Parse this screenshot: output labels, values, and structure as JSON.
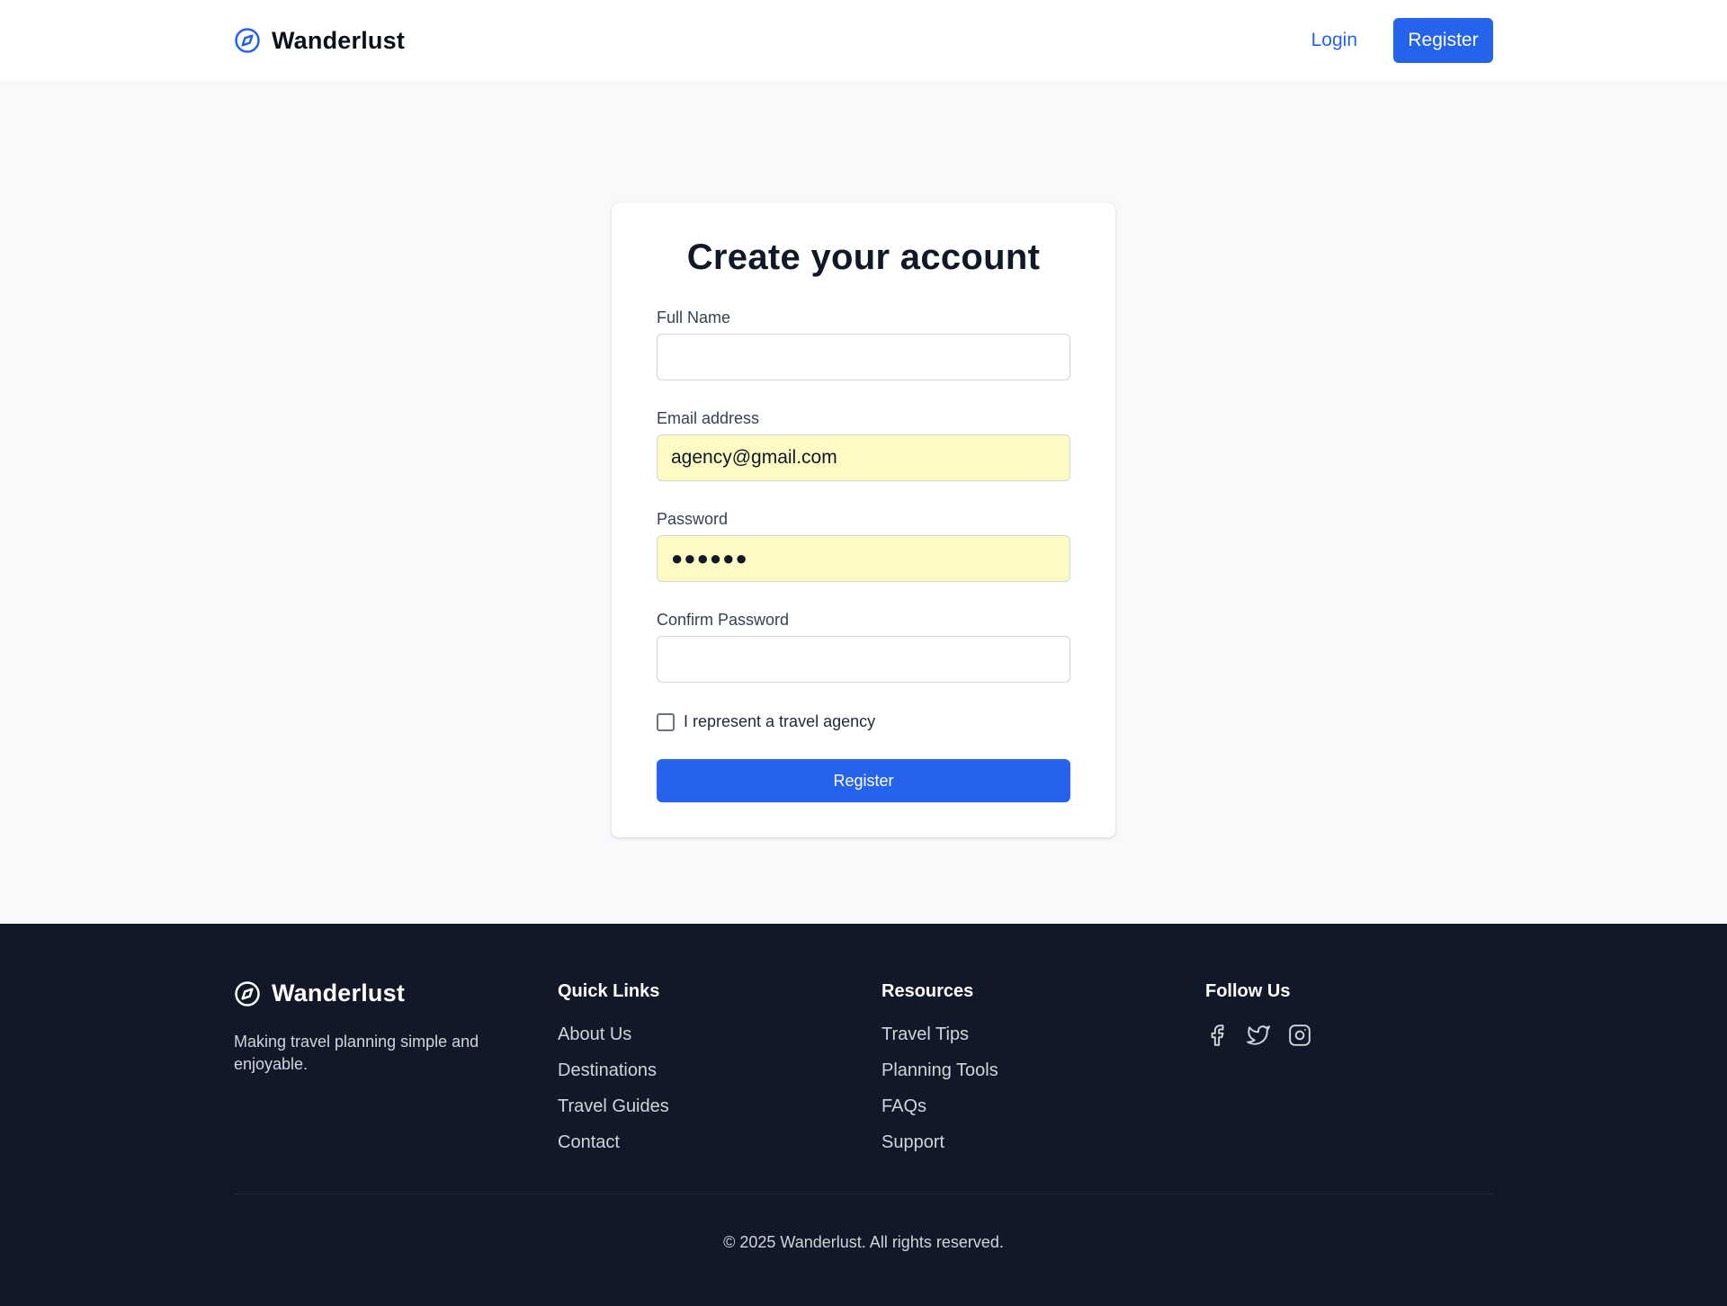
{
  "header": {
    "brand": "Wanderlust",
    "nav_login": "Login",
    "nav_register": "Register"
  },
  "form": {
    "title": "Create your account",
    "full_name": {
      "label": "Full Name",
      "value": ""
    },
    "email": {
      "label": "Email address",
      "value": "agency@gmail.com"
    },
    "password": {
      "label": "Password",
      "masked": "●●●●●●"
    },
    "confirm_password": {
      "label": "Confirm Password",
      "value": ""
    },
    "agency_checkbox": {
      "label": "I represent a travel agency",
      "checked": false
    },
    "submit": "Register"
  },
  "footer": {
    "brand": "Wanderlust",
    "tagline": "Making travel planning simple and enjoyable.",
    "quick_links": {
      "heading": "Quick Links",
      "items": [
        "About Us",
        "Destinations",
        "Travel Guides",
        "Contact"
      ]
    },
    "resources": {
      "heading": "Resources",
      "items": [
        "Travel Tips",
        "Planning Tools",
        "FAQs",
        "Support"
      ]
    },
    "follow": {
      "heading": "Follow Us",
      "icons": [
        "facebook-icon",
        "twitter-icon",
        "instagram-icon"
      ]
    },
    "copyright": "© 2025 Wanderlust. All rights reserved."
  },
  "colors": {
    "accent": "#2563eb",
    "autofill": "#fefac4",
    "footer_bg": "#111827",
    "page_bg": "#f8f9fb"
  }
}
